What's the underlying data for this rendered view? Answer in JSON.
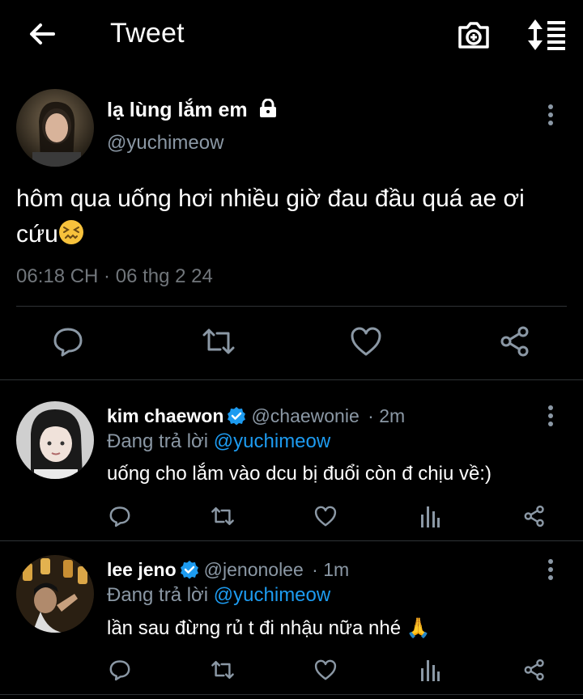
{
  "header": {
    "title": "Tweet",
    "icons": [
      "back-arrow-icon",
      "camera-icon",
      "sort-icon"
    ]
  },
  "main_tweet": {
    "display_name": "lạ lùng lắm em",
    "handle": "@yuchimeow",
    "text": "hôm qua uống hơi nhiều giờ đau đầu quá ae ơi cứu",
    "emoji": "confounded-face",
    "timestamp": "06:18 CH · 06 thg 2 24"
  },
  "replies": [
    {
      "display_name": "kim chaewon",
      "handle": "@chaewonie",
      "time": "· 2m",
      "reply_prefix": "Đang trả lời ",
      "reply_to": "@yuchimeow",
      "text": "uống cho lắm vào dcu bị đuổi còn đ chịu về:)"
    },
    {
      "display_name": "lee jeno",
      "handle": "@jenonolee",
      "time": "· 1m",
      "reply_prefix": "Đang trả lời ",
      "reply_to": "@yuchimeow",
      "text": "lần sau đừng rủ t đi nhậu nữa nhé 🙏"
    }
  ],
  "colors": {
    "background": "#000000",
    "link": "#1d9bf0",
    "verified": "#1d9bf0",
    "muted": "#8b98a5",
    "divider": "#2f3336"
  }
}
